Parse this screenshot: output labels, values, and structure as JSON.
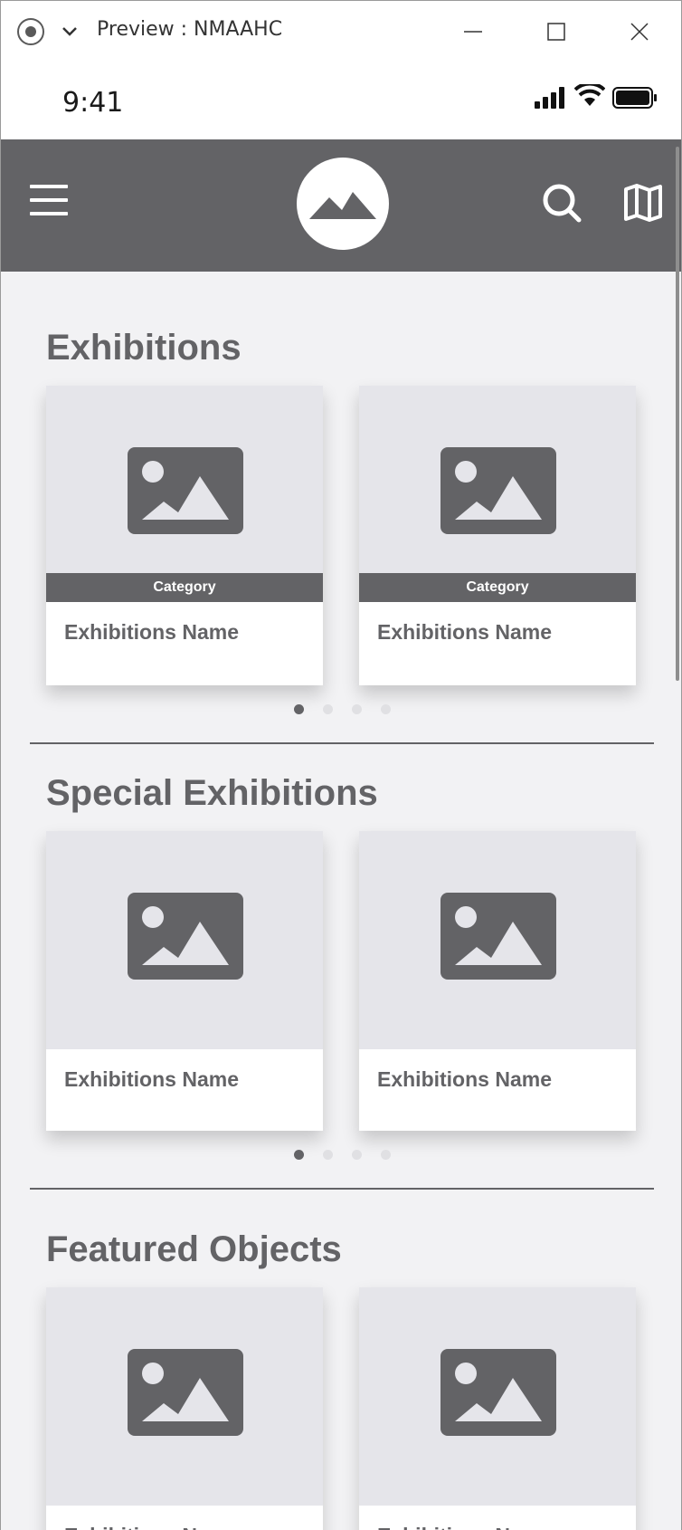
{
  "window": {
    "title": "Preview : NMAAHC"
  },
  "status_bar": {
    "time": "9:41"
  },
  "sections": [
    {
      "title": "Exhibitions",
      "cards": [
        {
          "category": "Category",
          "name": "Exhibitions Name"
        },
        {
          "category": "Category",
          "name": "Exhibitions Name"
        }
      ],
      "page_count": 4,
      "active_page": 1
    },
    {
      "title": "Special Exhibitions",
      "cards": [
        {
          "name": "Exhibitions Name"
        },
        {
          "name": "Exhibitions Name"
        }
      ],
      "page_count": 4,
      "active_page": 1
    },
    {
      "title": "Featured Objects",
      "cards": [
        {
          "name": "Exhibitions Name"
        },
        {
          "name": "Exhibitions Name"
        }
      ]
    }
  ],
  "icons": {
    "menu": "hamburger-menu-icon",
    "logo": "mountain-logo-icon",
    "search": "search-icon",
    "map": "map-icon"
  },
  "colors": {
    "primary": "#636366",
    "background": "#f2f2f4",
    "placeholder": "#e5e5ea"
  }
}
